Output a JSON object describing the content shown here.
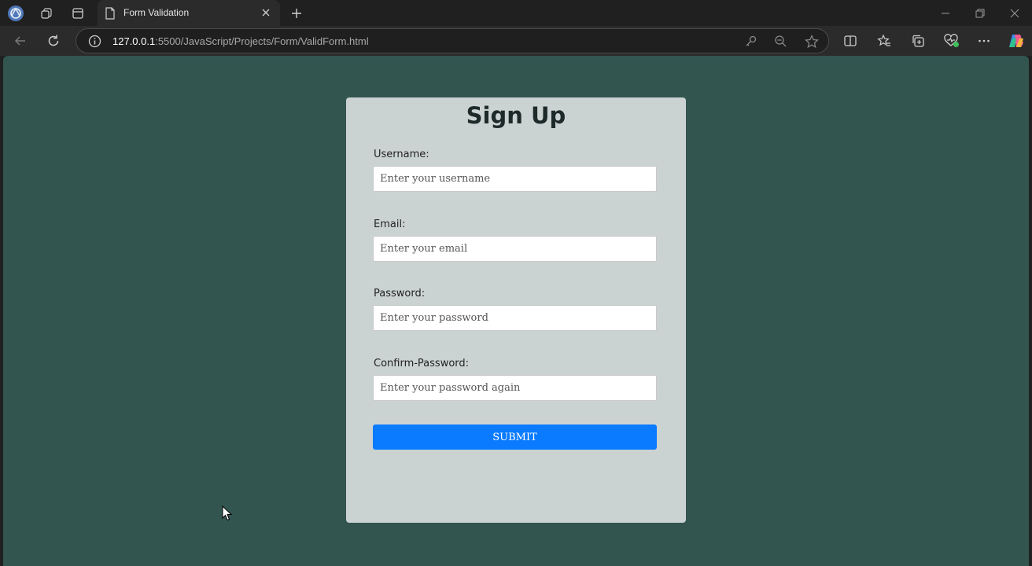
{
  "browser": {
    "tab_title": "Form Validation",
    "url_host": "127.0.0.1",
    "url_rest": ":5500/JavaScript/Projects/Form/ValidForm.html"
  },
  "page": {
    "bg_color": "#325550",
    "form": {
      "heading": "Sign Up",
      "username_label": "Username:",
      "username_placeholder": "Enter your username",
      "email_label": "Email:",
      "email_placeholder": "Enter your email",
      "password_label": "Password:",
      "password_placeholder": "Enter your password",
      "confirm_label": "Confirm-Password:",
      "confirm_placeholder": "Enter your password again",
      "submit_label": "SUBMIT",
      "submit_color": "#0a7bff"
    }
  }
}
